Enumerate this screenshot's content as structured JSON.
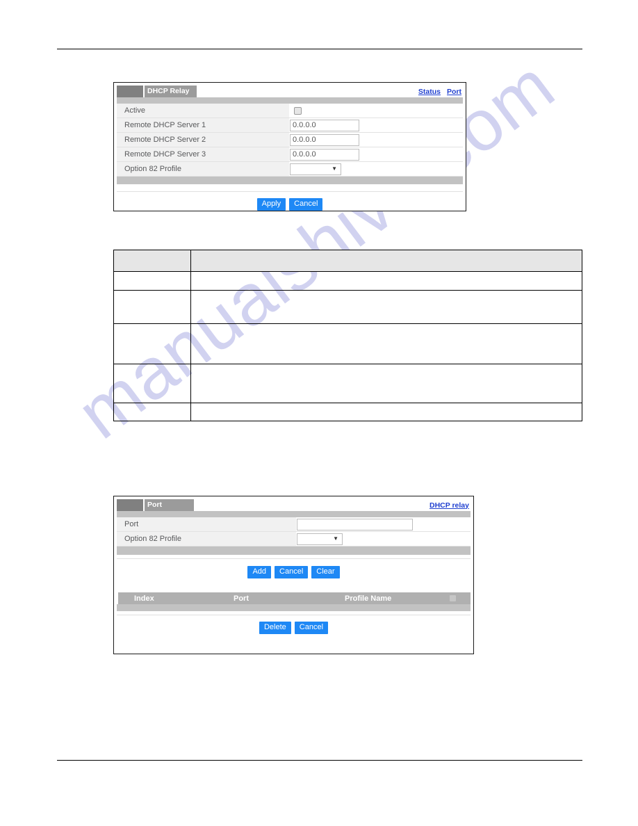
{
  "page": {
    "header_rule": true,
    "footer_rule": true,
    "watermark": "manualshive.com"
  },
  "dhcp_relay_panel": {
    "title": "DHCP Relay",
    "links": [
      {
        "label": "Status",
        "name": "status-link"
      },
      {
        "label": "Port",
        "name": "port-link"
      }
    ],
    "rows": [
      {
        "label": "Active",
        "control": "checkbox",
        "value": ""
      },
      {
        "label": "Remote DHCP Server 1",
        "control": "text",
        "value": "0.0.0.0"
      },
      {
        "label": "Remote DHCP Server 2",
        "control": "text",
        "value": "0.0.0.0"
      },
      {
        "label": "Remote DHCP Server 3",
        "control": "text",
        "value": "0.0.0.0"
      },
      {
        "label": "Option 82 Profile",
        "control": "select",
        "value": ""
      }
    ],
    "buttons": [
      {
        "label": "Apply",
        "name": "apply-button"
      },
      {
        "label": "Cancel",
        "name": "cancel-button"
      }
    ]
  },
  "description_table": {
    "headers": [
      "",
      ""
    ],
    "rows": [
      [
        "",
        ""
      ],
      [
        "",
        ""
      ],
      [
        "",
        ""
      ],
      [
        "",
        ""
      ],
      [
        "",
        ""
      ]
    ]
  },
  "port_panel": {
    "title": "Port",
    "links": [
      {
        "label": "DHCP relay",
        "name": "dhcp-relay-link"
      }
    ],
    "rows": [
      {
        "label": "Port",
        "control": "text",
        "value": ""
      },
      {
        "label": "Option 82 Profile",
        "control": "select",
        "value": ""
      }
    ],
    "buttons": [
      {
        "label": "Add",
        "name": "add-button"
      },
      {
        "label": "Cancel",
        "name": "cancel-button"
      },
      {
        "label": "Clear",
        "name": "clear-button"
      }
    ],
    "list_headers": [
      "Index",
      "Port",
      "Profile Name"
    ],
    "list_rows": [],
    "bottom_buttons": [
      {
        "label": "Delete",
        "name": "delete-button"
      },
      {
        "label": "Cancel",
        "name": "cancel-button"
      }
    ]
  },
  "colors": {
    "accent_button": "#1e88f5",
    "link": "#2040d0",
    "titlebar_stub": "#808080",
    "titlebar_label": "#9b9b9b",
    "subbar": "#c2c2c2",
    "row_label_bg": "#f1f1f1",
    "list_header_bg": "#b0b0b0",
    "watermark": "#c9cbee"
  }
}
